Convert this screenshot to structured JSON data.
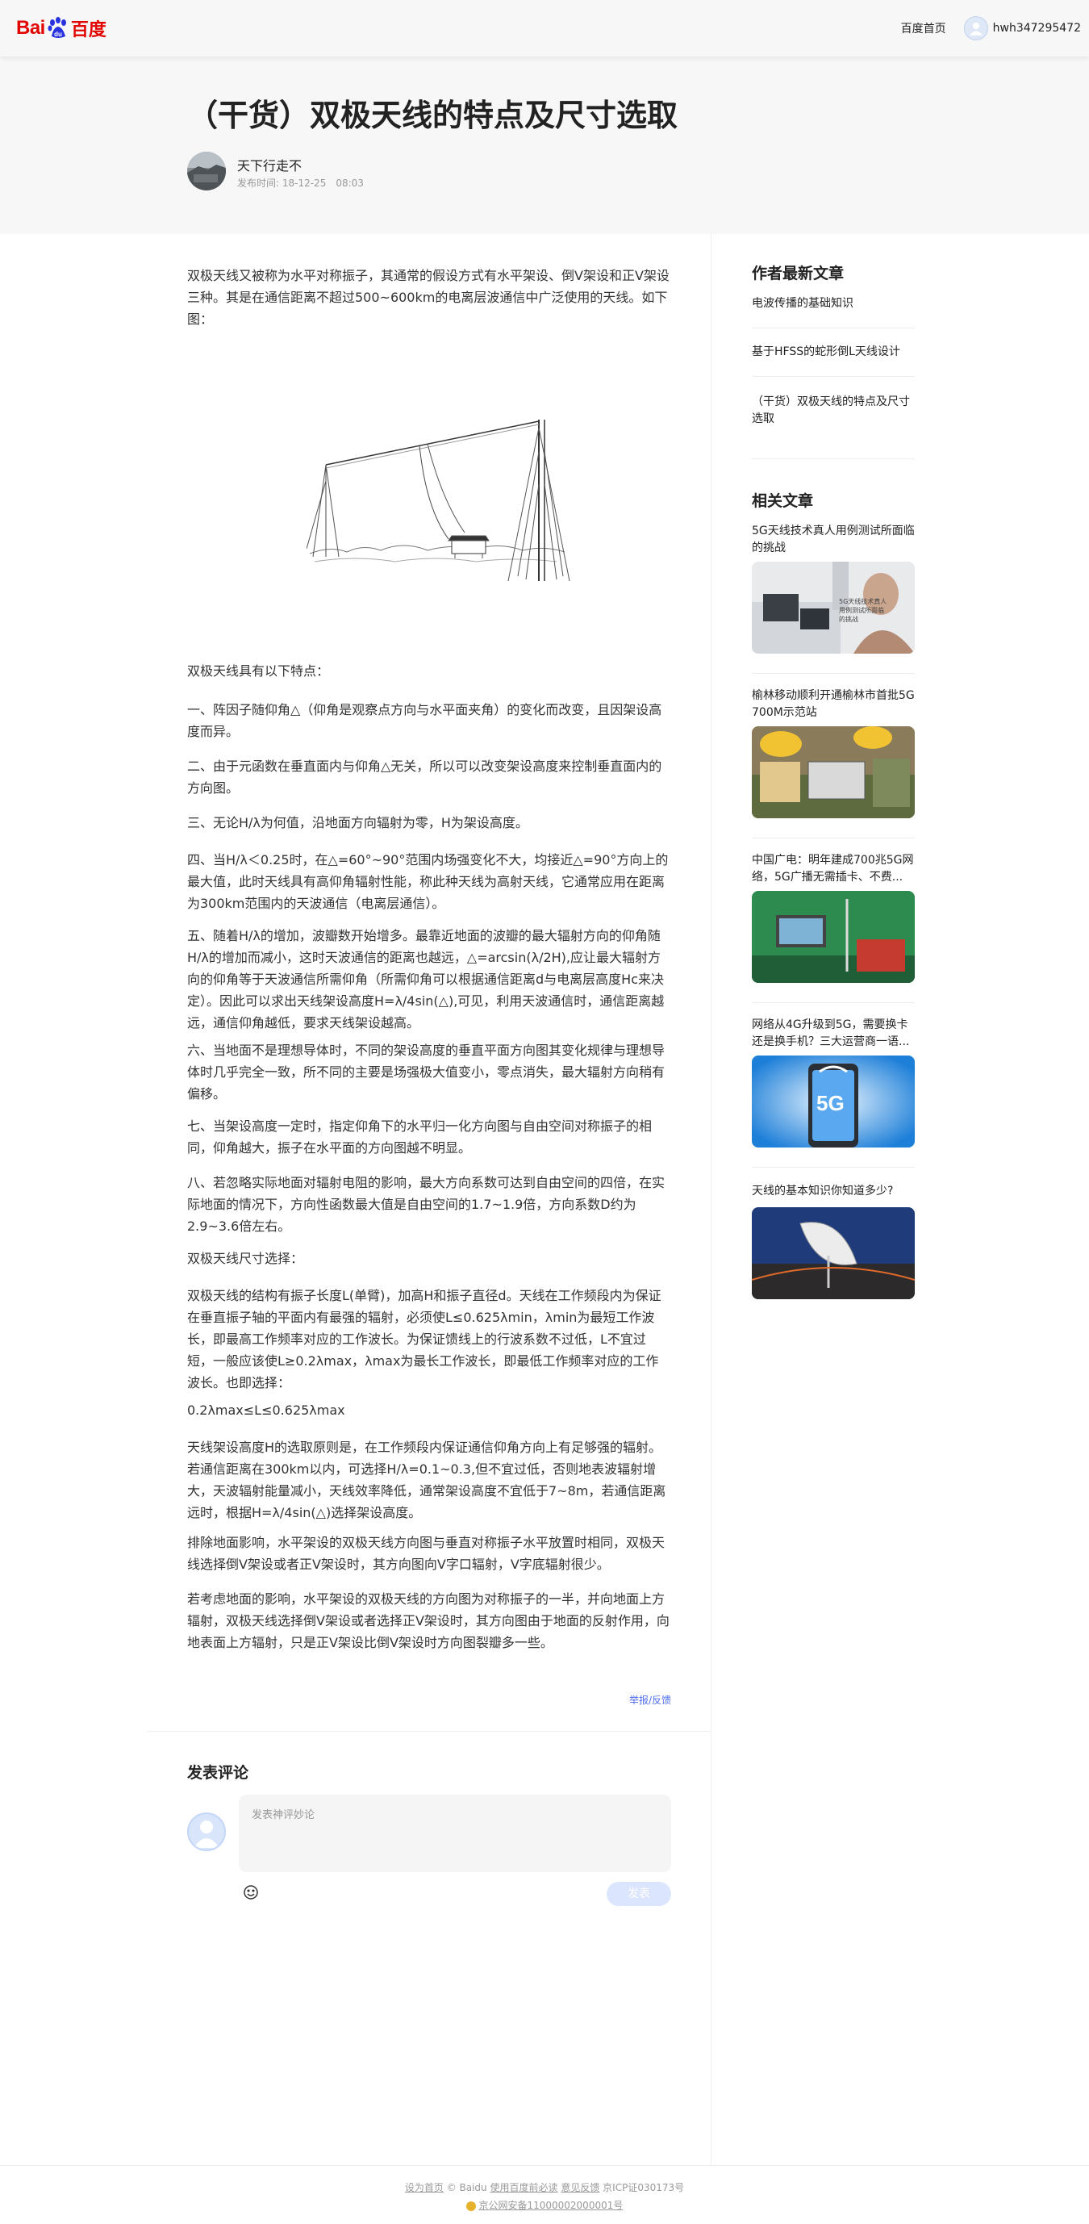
{
  "nav": {
    "logo_bai": "Bai",
    "logo_du": "百度",
    "home": "百度首页",
    "username": "hwh347295472"
  },
  "article": {
    "title": "（干货）双极天线的特点及尺寸选取",
    "author": "天下行走不",
    "pub_time": "发布时间: 18-12-25　08:03",
    "paragraphs": [
      "双极天线又被称为水平对称振子，其通常的假设方式有水平架设、倒V架设和正V架设三种。其是在通信距离不超过500~600km的电离层波通信中广泛使用的天线。如下图：",
      "双极天线具有以下特点：",
      "一、阵因子随仰角△（仰角是观察点方向与水平面夹角）的变化而改变，且因架设高度而异。",
      "二、由于元函数在垂直面内与仰角△无关，所以可以改变架设高度来控制垂直面内的方向图。",
      "三、无论H/λ为何值，沿地面方向辐射为零，H为架设高度。",
      "四、当H/λ＜0.25时，在△=60°~90°范围内场强变化不大，均接近△=90°方向上的最大值，此时天线具有高仰角辐射性能，称此种天线为高射天线，它通常应用在距离为300km范围内的天波通信（电离层通信）。",
      "五、随着H/λ的增加，波瓣数开始增多。最靠近地面的波瓣的最大辐射方向的仰角随H/λ的增加而减小，这时天波通信的距离也越远，△=arcsin(λ/2H),应让最大辐射方向的仰角等于天波通信所需仰角（所需仰角可以根据通信距离d与电离层高度Hc来决定）。因此可以求出天线架设高度H=λ/4sin(△),可见，利用天波通信时，通信距离越远，通信仰角越低，要求天线架设越高。",
      "六、当地面不是理想导体时，不同的架设高度的垂直平面方向图其变化规律与理想导体时几乎完全一致，所不同的主要是场强极大值变小，零点消失，最大辐射方向稍有偏移。",
      "七、当架设高度一定时，指定仰角下的水平归一化方向图与自由空间对称振子的相同，仰角越大，振子在水平面的方向图越不明显。",
      "八、若忽略实际地面对辐射电阻的影响，最大方向系数可达到自由空间的四倍，在实际地面的情况下，方向性函数最大值是自由空间的1.7~1.9倍，方向系数D约为2.9~3.6倍左右。",
      "双极天线尺寸选择：",
      "双极天线的结构有振子长度L(单臂)，加高H和振子直径d。天线在工作频段内为保证在垂直振子轴的平面内有最强的辐射，必须使L≤0.625λmin，λmin为最短工作波长，即最高工作频率对应的工作波长。为保证馈线上的行波系数不过低，L不宜过短，一般应该使L≥0.2λmax，λmax为最长工作波长，即最低工作频率对应的工作波长。也即选择：",
      "0.2λmax≤L≤0.625λmax",
      "天线架设高度H的选取原则是，在工作频段内保证通信仰角方向上有足够强的辐射。若通信距离在300km以内，可选择H/λ=0.1~0.3,但不宜过低，否则地表波辐射增大，天波辐射能量减小，天线效率降低，通常架设高度不宜低于7~8m，若通信距离远时，根据H=λ/4sin(△)选择架设高度。",
      "排除地面影响，水平架设的双极天线方向图与垂直对称振子水平放置时相同，双极天线选择倒V架设或者正V架设时，其方向图向V字口辐射，V字底辐射很少。",
      "若考虑地面的影响，水平架设的双极天线的方向图为对称振子的一半，并向地面上方辐射，双极天线选择倒V架设或者选择正V架设时，其方向图由于地面的反射作用，向地表面上方辐射，只是正V架设比倒V架设时方向图裂瓣多一些。"
    ],
    "report": "举报/反馈"
  },
  "comments": {
    "title": "发表评论",
    "placeholder": "发表神评妙论",
    "submit": "发表"
  },
  "sidebar": {
    "latest_title": "作者最新文章",
    "latest": [
      "电波传播的基础知识",
      "基于HFSS的蛇形倒L天线设计",
      "（干货）双极天线的特点及尺寸选取"
    ],
    "related_title": "相关文章",
    "related": [
      {
        "title": "5G天线技术真人用例测试所面临的挑战",
        "img_text": "5G天线技术真人用例测试所面临的挑战"
      },
      {
        "title": "榆林移动顺利开通榆林市首批5G 700M示范站"
      },
      {
        "title": "中国广电：明年建成700兆5G网络，5G广播无需插卡、不费..."
      },
      {
        "title": "网络从4G升级到5G，需要换卡还是换手机？三大运营商一语...",
        "img_text": "5G"
      },
      {
        "title": "天线的基本知识你知道多少?"
      }
    ]
  },
  "footer": {
    "line1_link1": "设为首页",
    "line1_text": "© Baidu",
    "line1_link2": "使用百度前必读",
    "line1_link3": "意见反馈",
    "line1_icp": "京ICP证030173号",
    "line2": "京公网安备11000002000001号"
  },
  "colors": {
    "brand_red": "#e10601",
    "link_blue": "#4e6ef2"
  }
}
